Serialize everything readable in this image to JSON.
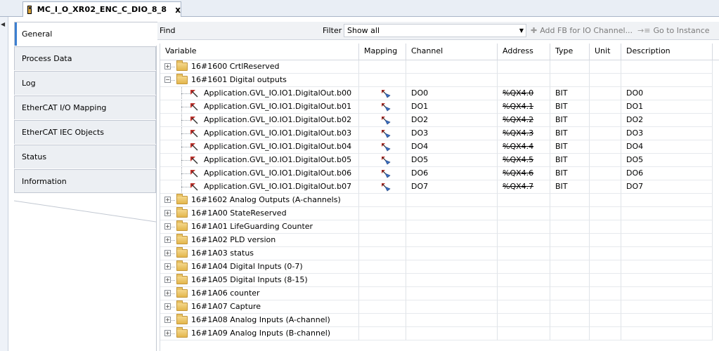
{
  "editor_tab": {
    "title": "MC_I_O_XR02_ENC_C_DIO_8_8",
    "close": "x"
  },
  "side_tabs": [
    {
      "label": "General",
      "active": true
    },
    {
      "label": "Process Data",
      "active": false
    },
    {
      "label": "Log",
      "active": false
    },
    {
      "label": "EtherCAT I/O Mapping",
      "active": false
    },
    {
      "label": "EtherCAT IEC Objects",
      "active": false
    },
    {
      "label": "Status",
      "active": false
    },
    {
      "label": "Information",
      "active": false
    }
  ],
  "toolbar": {
    "find_label": "Find",
    "find_value": "",
    "filter_label": "Filter",
    "filter_value": "Show all",
    "add_fb_label": "Add FB for IO Channel...",
    "goto_label": "Go to Instance"
  },
  "columns": [
    "Variable",
    "Mapping",
    "Channel",
    "Address",
    "Type",
    "Unit",
    "Description"
  ],
  "rows": [
    {
      "kind": "group",
      "expanded": false,
      "variable": "16#1600 CrtlReserved"
    },
    {
      "kind": "group",
      "expanded": true,
      "variable": "16#1601 Digital outputs"
    },
    {
      "kind": "var",
      "variable": "Application.GVL_IO.IO1.DigitalOut.b00",
      "channel": "DO0",
      "address": "%QX4.0",
      "type": "BIT",
      "unit": "",
      "description": "DO0"
    },
    {
      "kind": "var",
      "variable": "Application.GVL_IO.IO1.DigitalOut.b01",
      "channel": "DO1",
      "address": "%QX4.1",
      "type": "BIT",
      "unit": "",
      "description": "DO1"
    },
    {
      "kind": "var",
      "variable": "Application.GVL_IO.IO1.DigitalOut.b02",
      "channel": "DO2",
      "address": "%QX4.2",
      "type": "BIT",
      "unit": "",
      "description": "DO2"
    },
    {
      "kind": "var",
      "variable": "Application.GVL_IO.IO1.DigitalOut.b03",
      "channel": "DO3",
      "address": "%QX4.3",
      "type": "BIT",
      "unit": "",
      "description": "DO3"
    },
    {
      "kind": "var",
      "variable": "Application.GVL_IO.IO1.DigitalOut.b04",
      "channel": "DO4",
      "address": "%QX4.4",
      "type": "BIT",
      "unit": "",
      "description": "DO4"
    },
    {
      "kind": "var",
      "variable": "Application.GVL_IO.IO1.DigitalOut.b05",
      "channel": "DO5",
      "address": "%QX4.5",
      "type": "BIT",
      "unit": "",
      "description": "DO5"
    },
    {
      "kind": "var",
      "variable": "Application.GVL_IO.IO1.DigitalOut.b06",
      "channel": "DO6",
      "address": "%QX4.6",
      "type": "BIT",
      "unit": "",
      "description": "DO6"
    },
    {
      "kind": "var",
      "variable": "Application.GVL_IO.IO1.DigitalOut.b07",
      "channel": "DO7",
      "address": "%QX4.7",
      "type": "BIT",
      "unit": "",
      "description": "DO7"
    },
    {
      "kind": "group",
      "expanded": false,
      "variable": "16#1602 Analog Outputs (A-channels)"
    },
    {
      "kind": "group",
      "expanded": false,
      "variable": "16#1A00 StateReserved"
    },
    {
      "kind": "group",
      "expanded": false,
      "variable": "16#1A01 LifeGuarding Counter"
    },
    {
      "kind": "group",
      "expanded": false,
      "variable": "16#1A02 PLD version"
    },
    {
      "kind": "group",
      "expanded": false,
      "variable": "16#1A03 status"
    },
    {
      "kind": "group",
      "expanded": false,
      "variable": "16#1A04 Digital Inputs (0-7)"
    },
    {
      "kind": "group",
      "expanded": false,
      "variable": "16#1A05 Digital Inputs (8-15)"
    },
    {
      "kind": "group",
      "expanded": false,
      "variable": "16#1A06 counter"
    },
    {
      "kind": "group",
      "expanded": false,
      "variable": "16#1A07 Capture"
    },
    {
      "kind": "group",
      "expanded": false,
      "variable": "16#1A08 Analog Inputs (A-channel)"
    },
    {
      "kind": "group",
      "expanded": false,
      "variable": "16#1A09 Analog Inputs (B-channel)"
    }
  ],
  "colors": {
    "accent": "#3c7fd1",
    "grid_line": "#dfe3e8",
    "folder": "#e3b64c"
  },
  "icons": {
    "group": "folder-icon",
    "var": "output-variable-icon",
    "mapping": "mapping-existing-variable-icon"
  }
}
